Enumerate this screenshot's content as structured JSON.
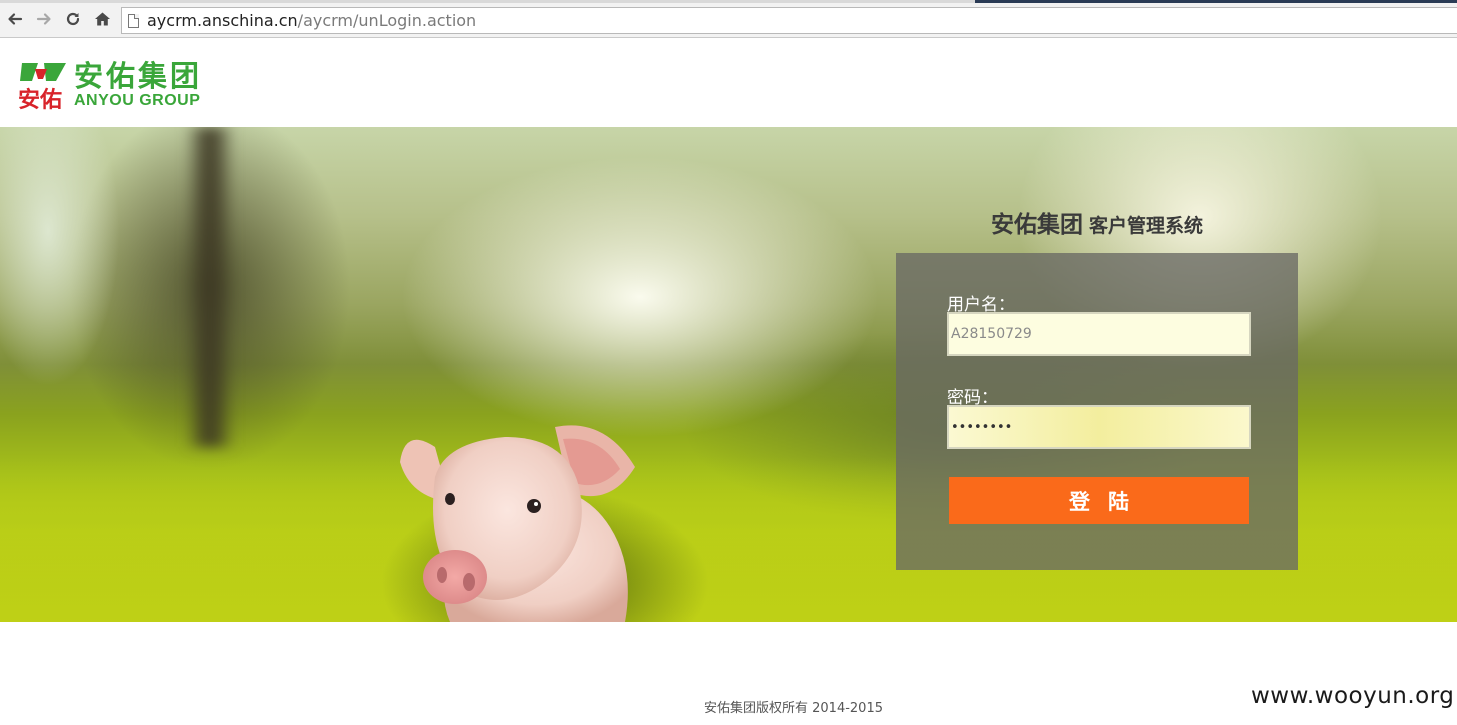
{
  "browser": {
    "url_host": "aycrm.anschina.cn",
    "url_path": "/aycrm/unLogin.action",
    "back_icon": "arrow-left-icon",
    "forward_icon": "arrow-right-icon",
    "reload_icon": "reload-icon",
    "home_icon": "home-icon"
  },
  "logo": {
    "cn": "安佑集团",
    "en": "ANYOU GROUP",
    "mark_text": "安佑",
    "brand_green": "#3aa63a",
    "brand_red": "#d8232a"
  },
  "login": {
    "title_main": "安佑集团",
    "title_sub": "客户管理系统",
    "username_label": "用户名：",
    "username_value": "A28150729",
    "password_label": "密码：",
    "password_value": "••••••••",
    "submit_label": "登陆",
    "accent_color": "#fa6a1a"
  },
  "footer": {
    "copyright": "安佑集团版权所有 2014-2015",
    "watermark": "www.wooyun.org"
  }
}
